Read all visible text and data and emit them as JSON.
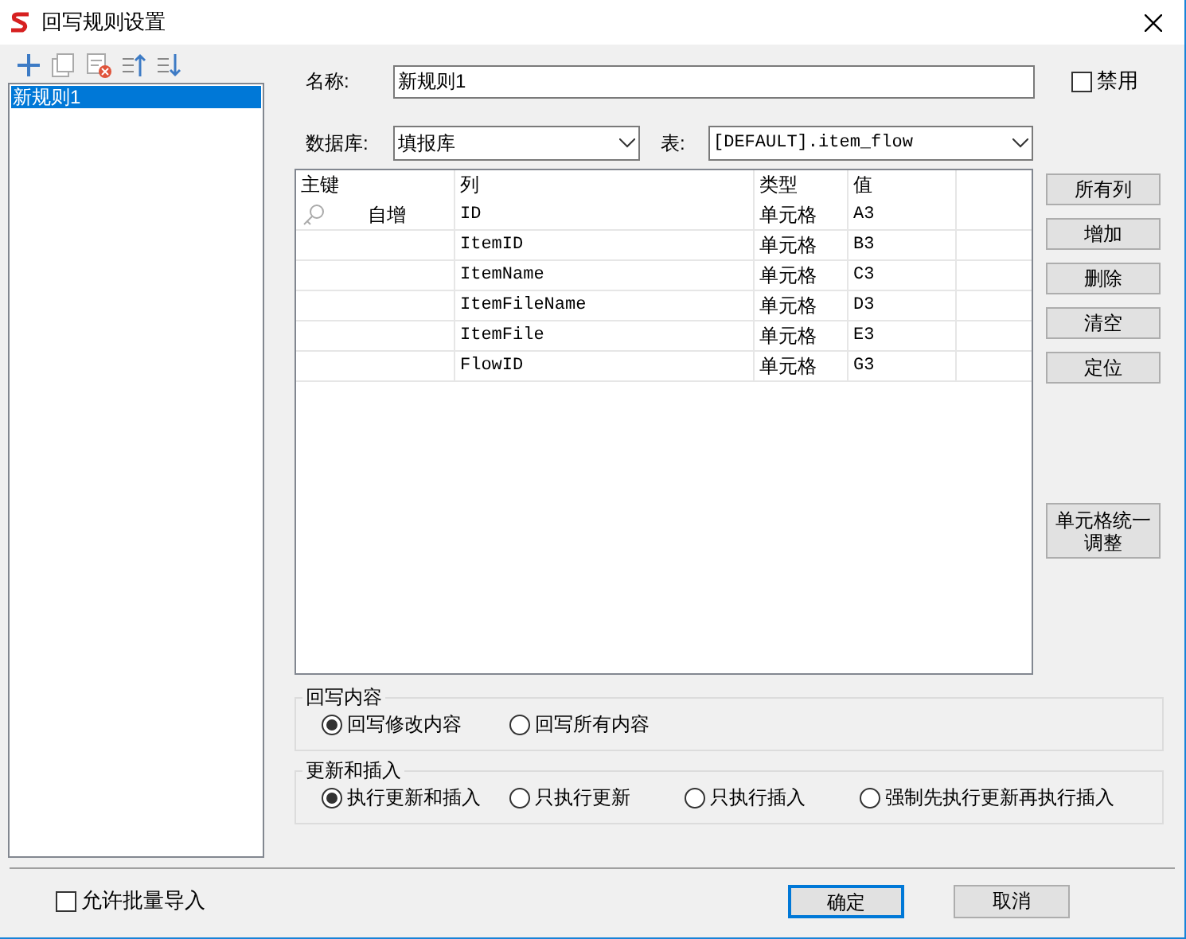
{
  "window": {
    "title": "回写规则设置"
  },
  "rules": [
    {
      "label": "新规则1",
      "selected": true
    }
  ],
  "name_field": {
    "label": "名称:",
    "value": "新规则1"
  },
  "disable": {
    "label": "禁用",
    "checked": false
  },
  "database": {
    "label": "数据库:",
    "value": "填报库"
  },
  "table_select": {
    "label": "表:",
    "value": "[DEFAULT].item_flow"
  },
  "table": {
    "columns": [
      "主键",
      "列",
      "类型",
      "值"
    ],
    "rows": [
      {
        "primary_key": true,
        "key_text": "自增",
        "column": "ID",
        "type": "单元格",
        "value": "A3"
      },
      {
        "primary_key": false,
        "column": "ItemID",
        "type": "单元格",
        "value": "B3"
      },
      {
        "primary_key": false,
        "column": "ItemName",
        "type": "单元格",
        "value": "C3"
      },
      {
        "primary_key": false,
        "column": "ItemFileName",
        "type": "单元格",
        "value": "D3"
      },
      {
        "primary_key": false,
        "column": "ItemFile",
        "type": "单元格",
        "value": "E3"
      },
      {
        "primary_key": false,
        "column": "FlowID",
        "type": "单元格",
        "value": "G3"
      }
    ]
  },
  "side_buttons": [
    "所有列",
    "增加",
    "删除",
    "清空",
    "定位"
  ],
  "adjust_button": "单元格统一调整",
  "groups": [
    {
      "title": "回写内容",
      "options": [
        {
          "label": "回写修改内容",
          "selected": true
        },
        {
          "label": "回写所有内容",
          "selected": false
        }
      ]
    },
    {
      "title": "更新和插入",
      "options": [
        {
          "label": "执行更新和插入",
          "selected": true
        },
        {
          "label": "只执行更新",
          "selected": false
        },
        {
          "label": "只执行插入",
          "selected": false
        },
        {
          "label": "强制先执行更新再执行插入",
          "selected": false
        }
      ]
    }
  ],
  "batch_import": {
    "label": "允许批量导入",
    "checked": false
  },
  "buttons": [
    {
      "label": "确定",
      "default": true
    },
    {
      "label": "取消",
      "default": false
    }
  ]
}
